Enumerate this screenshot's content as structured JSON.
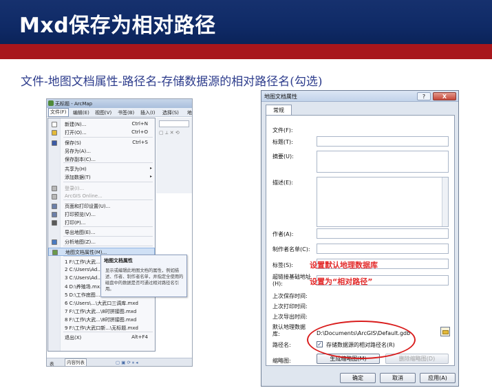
{
  "slide": {
    "title": "Mxd保存为相对路径",
    "subtitle": "文件-地图文档属性-路径名-存储数据源的相对路径名(勾选)"
  },
  "arcmap": {
    "window_title": "无标题 - ArcMap",
    "menubar": [
      "文件(F)",
      "编辑(E)",
      "视图(V)",
      "书签(B)",
      "插入(I)",
      "选择(S)",
      "地"
    ],
    "file_menu": [
      {
        "label": "新建(N)...",
        "shortcut": "Ctrl+N",
        "icon": "new-doc-icon"
      },
      {
        "label": "打开(O)...",
        "shortcut": "Ctrl+O",
        "icon": "open-folder-icon"
      },
      {
        "label": "保存(S)",
        "shortcut": "Ctrl+S",
        "icon": "save-icon"
      },
      {
        "label": "另存为(A)...",
        "shortcut": ""
      },
      {
        "label": "保存副本(C)...",
        "shortcut": ""
      },
      {
        "label": "共享为(H)",
        "shortcut": "",
        "submenu": true
      },
      {
        "label": "添加数据(T)",
        "shortcut": "",
        "submenu": true
      },
      {
        "label": "登录(I)...",
        "shortcut": "",
        "disabled": true,
        "icon": "login-icon"
      },
      {
        "label": "ArcGIS Online...",
        "shortcut": "",
        "disabled": true,
        "icon": "globe-icon"
      },
      {
        "label": "页面和打印设置(U)...",
        "shortcut": "",
        "icon": "page-setup-icon"
      },
      {
        "label": "打印预览(V)...",
        "shortcut": "",
        "icon": "print-preview-icon"
      },
      {
        "label": "打印(P)...",
        "shortcut": "",
        "icon": "printer-icon"
      },
      {
        "label": "导出地图(E)...",
        "shortcut": ""
      },
      {
        "label": "分析地图(Z)...",
        "shortcut": "",
        "icon": "analyze-icon"
      },
      {
        "label": "地图文档属性(M)...",
        "shortcut": "",
        "icon": "properties-icon",
        "highlight": true
      },
      {
        "label": "1 F:\\工作\\大武...",
        "shortcut": ""
      },
      {
        "label": "2 C:\\Users\\Ad...",
        "shortcut": ""
      },
      {
        "label": "3 C:\\Users\\Ad...",
        "shortcut": ""
      },
      {
        "label": "4 D:\\养殖场.mx...",
        "shortcut": ""
      },
      {
        "label": "5 D:\\工作底图...",
        "shortcut": ""
      },
      {
        "label": "6 C:\\Users\\...\\大武口三调库.mxd",
        "shortcut": ""
      },
      {
        "label": "7 F:\\工作\\大武...\\8时拼接图.mxd",
        "shortcut": ""
      },
      {
        "label": "8 F:\\工作\\大武...\\8时拼接图.mxd",
        "shortcut": ""
      },
      {
        "label": "9 F:\\工作\\大武口新...\\无标题.mxd",
        "shortcut": ""
      },
      {
        "label": "退出(X)",
        "shortcut": "Alt+F4"
      }
    ],
    "tooltip": {
      "title": "地图文档属性",
      "body": "显示或编辑此地图文档的属性，例如描述、作者、制作者名单，并指定全使用的磁盘中的数据是否可通过相对路径名引用。"
    },
    "status": {
      "tab1": "表",
      "tab2": "内容列表"
    }
  },
  "dialog": {
    "title": "地图文档属性",
    "help": "?",
    "close": "X",
    "tab": "常规",
    "fields": {
      "file": "文件(F):",
      "title": "标题(T):",
      "summary": "摘要(U):",
      "description": "描述(E):",
      "author": "作者(A):",
      "credits": "制作者名单(C):",
      "tags": "标签(S):",
      "hyperlink": "超链接基础地址(H):",
      "last_saved": "上次保存时间:",
      "last_printed": "上次打印时间:",
      "last_exported": "上次导出时间:",
      "default_gdb": "默认地理数据库:",
      "pathnames": "路径名:",
      "thumbnail": "缩略图:"
    },
    "values": {
      "default_gdb_path": "D:\\Documents\\ArcGIS\\Default.gdb",
      "relative_path_checkbox": "存储数据源的相对路径名(R)",
      "relative_path_checked": true
    },
    "annotations": {
      "tags_note": "设置默认地理数据库",
      "hyperlink_note": "设置为“相对路径”"
    },
    "buttons": {
      "make_thumbnail": "生成缩略图(M)",
      "delete_thumbnail": "删除缩略图(D)",
      "ok": "确定",
      "cancel": "取消",
      "apply": "应用(A)"
    }
  }
}
